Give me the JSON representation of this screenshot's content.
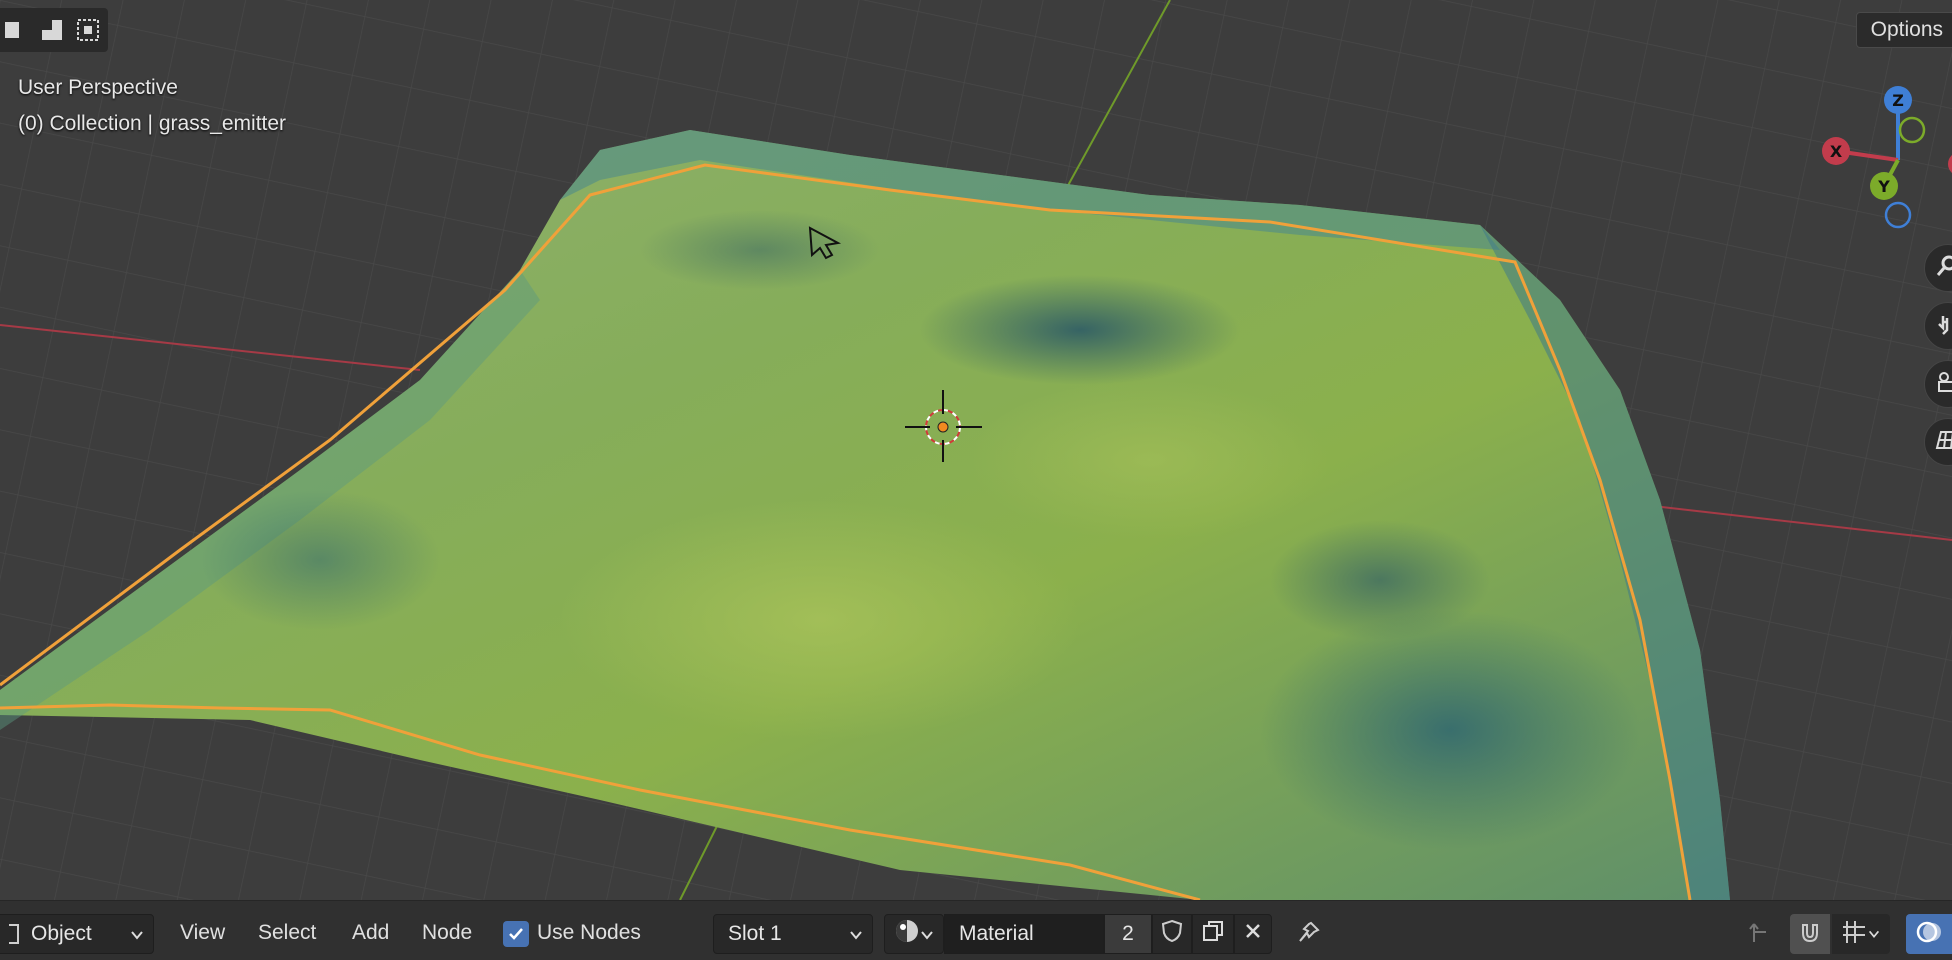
{
  "viewport": {
    "view_name": "User Perspective",
    "object_info": "(0) Collection | grass_emitter",
    "options_label": "Options",
    "gizmo": {
      "z_label": "Z",
      "x_label": "X",
      "y_label": "Y"
    }
  },
  "header": {
    "mode_label": "Object",
    "menus": {
      "view": "View",
      "select": "Select",
      "add": "Add",
      "node": "Node"
    },
    "use_nodes_label": "Use Nodes",
    "use_nodes_checked": true,
    "slot_label": "Slot 1",
    "material_name": "Material",
    "user_count": "2"
  },
  "colors": {
    "grid_bg": "#3d3d3d",
    "selection_outline": "#f0a13a",
    "x_axis": "#c23c4c",
    "y_axis": "#7cab2a",
    "z_axis": "#3f7fd6",
    "accent": "#4772b3"
  },
  "icons": [
    "select-box-icon",
    "select-extend-icon",
    "select-subtract-icon",
    "zoom-icon",
    "hand-pan-icon",
    "camera-icon",
    "perspective-toggle-icon",
    "shading-sphere-icon",
    "fake-user-shield-icon",
    "duplicate-icon",
    "close-icon",
    "pin-icon",
    "transform-pivot-icon",
    "snap-magnet-icon",
    "grid-snap-icon",
    "overlay-icon",
    "cursor-icon",
    "3d-cursor-icon"
  ]
}
